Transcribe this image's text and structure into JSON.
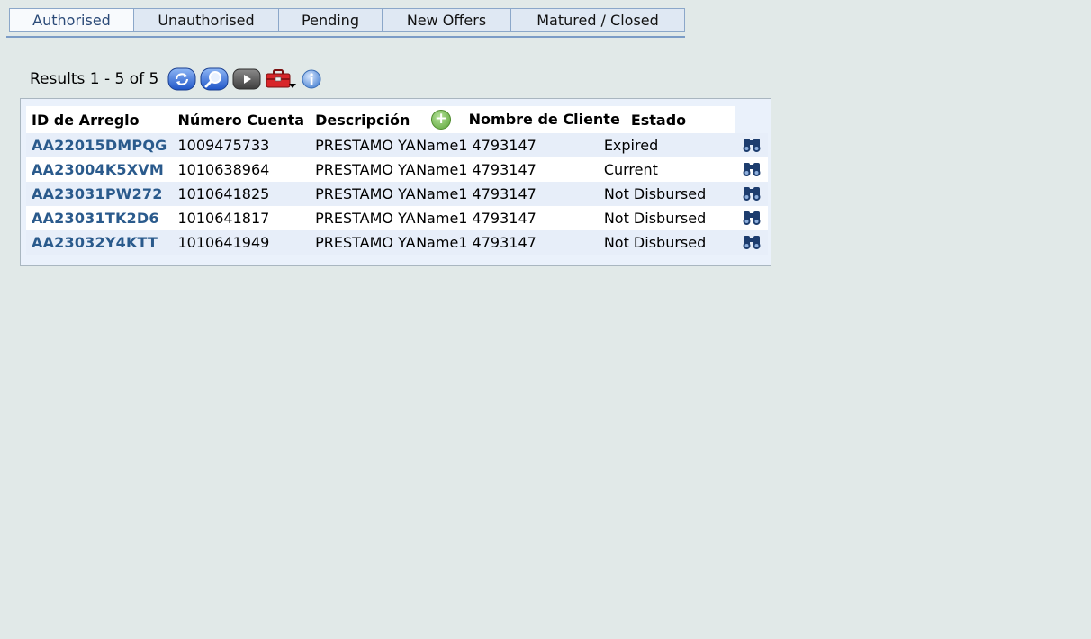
{
  "tabs": [
    {
      "label": "Authorised",
      "active": true
    },
    {
      "label": "Unauthorised",
      "active": false
    },
    {
      "label": "Pending",
      "active": false
    },
    {
      "label": "New Offers",
      "active": false
    },
    {
      "label": "Matured / Closed",
      "active": false
    }
  ],
  "toolbar": {
    "results_text": "Results 1 - 5 of 5",
    "icons": [
      "refresh-icon",
      "search-icon",
      "next-icon",
      "toolbox-icon",
      "info-icon"
    ]
  },
  "table": {
    "headers": [
      "ID de Arreglo",
      "Número Cuenta",
      "Descripción",
      "Nombre de Cliente",
      "Estado"
    ],
    "rows": [
      {
        "id": "AA22015DMPQG",
        "account": "1009475733",
        "description": "PRESTAMO YA",
        "client": "Name1 4793147",
        "status": "Expired"
      },
      {
        "id": "AA23004K5XVM",
        "account": "1010638964",
        "description": "PRESTAMO YA",
        "client": "Name1 4793147",
        "status": "Current"
      },
      {
        "id": "AA23031PW272",
        "account": "1010641825",
        "description": "PRESTAMO YA",
        "client": "Name1 4793147",
        "status": "Not Disbursed"
      },
      {
        "id": "AA23031TK2D6",
        "account": "1010641817",
        "description": "PRESTAMO YA",
        "client": "Name1 4793147",
        "status": "Not Disbursed"
      },
      {
        "id": "AA23032Y4KTT",
        "account": "1010641949",
        "description": "PRESTAMO YA",
        "client": "Name1 4793147",
        "status": "Not Disbursed"
      }
    ]
  },
  "colors": {
    "background": "#e1e9e8",
    "link": "#2a5a8c",
    "tab_border": "#7b9cc6"
  }
}
